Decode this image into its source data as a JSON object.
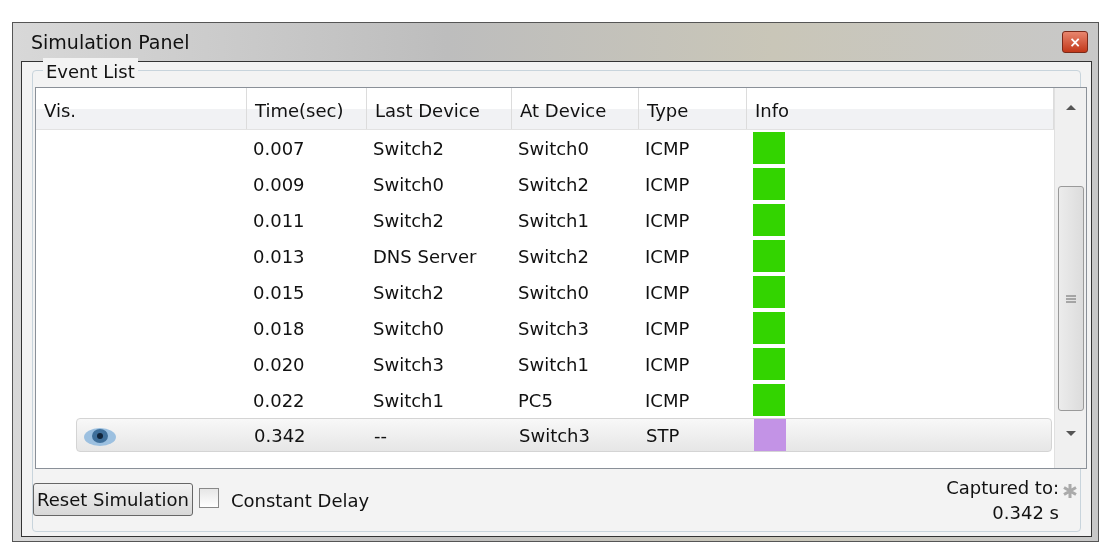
{
  "window": {
    "title": "Simulation Panel",
    "close": "×"
  },
  "event_list": {
    "title": "Event List",
    "columns": [
      "Vis.",
      "Time(sec)",
      "Last Device",
      "At Device",
      "Type",
      "Info"
    ],
    "rows": [
      {
        "visible": false,
        "time": "0.007",
        "last_device": "Switch2",
        "at_device": "Switch0",
        "type": "ICMP",
        "color": "#33d400",
        "selected": false
      },
      {
        "visible": false,
        "time": "0.009",
        "last_device": "Switch0",
        "at_device": "Switch2",
        "type": "ICMP",
        "color": "#33d400",
        "selected": false
      },
      {
        "visible": false,
        "time": "0.011",
        "last_device": "Switch2",
        "at_device": "Switch1",
        "type": "ICMP",
        "color": "#33d400",
        "selected": false
      },
      {
        "visible": false,
        "time": "0.013",
        "last_device": "DNS Server",
        "at_device": "Switch2",
        "type": "ICMP",
        "color": "#33d400",
        "selected": false
      },
      {
        "visible": false,
        "time": "0.015",
        "last_device": "Switch2",
        "at_device": "Switch0",
        "type": "ICMP",
        "color": "#33d400",
        "selected": false
      },
      {
        "visible": false,
        "time": "0.018",
        "last_device": "Switch0",
        "at_device": "Switch3",
        "type": "ICMP",
        "color": "#33d400",
        "selected": false
      },
      {
        "visible": false,
        "time": "0.020",
        "last_device": "Switch3",
        "at_device": "Switch1",
        "type": "ICMP",
        "color": "#33d400",
        "selected": false
      },
      {
        "visible": false,
        "time": "0.022",
        "last_device": "Switch1",
        "at_device": "PC5",
        "type": "ICMP",
        "color": "#33d400",
        "selected": false
      },
      {
        "visible": true,
        "time": "0.342",
        "last_device": "--",
        "at_device": "Switch3",
        "type": "STP",
        "color": "#c393e6",
        "selected": true
      }
    ]
  },
  "reset_button": "Reset Simulation",
  "constant_delay": {
    "label": "Constant Delay",
    "checked": false
  },
  "captured": {
    "label": "Captured to:",
    "value": "0.342 s"
  }
}
